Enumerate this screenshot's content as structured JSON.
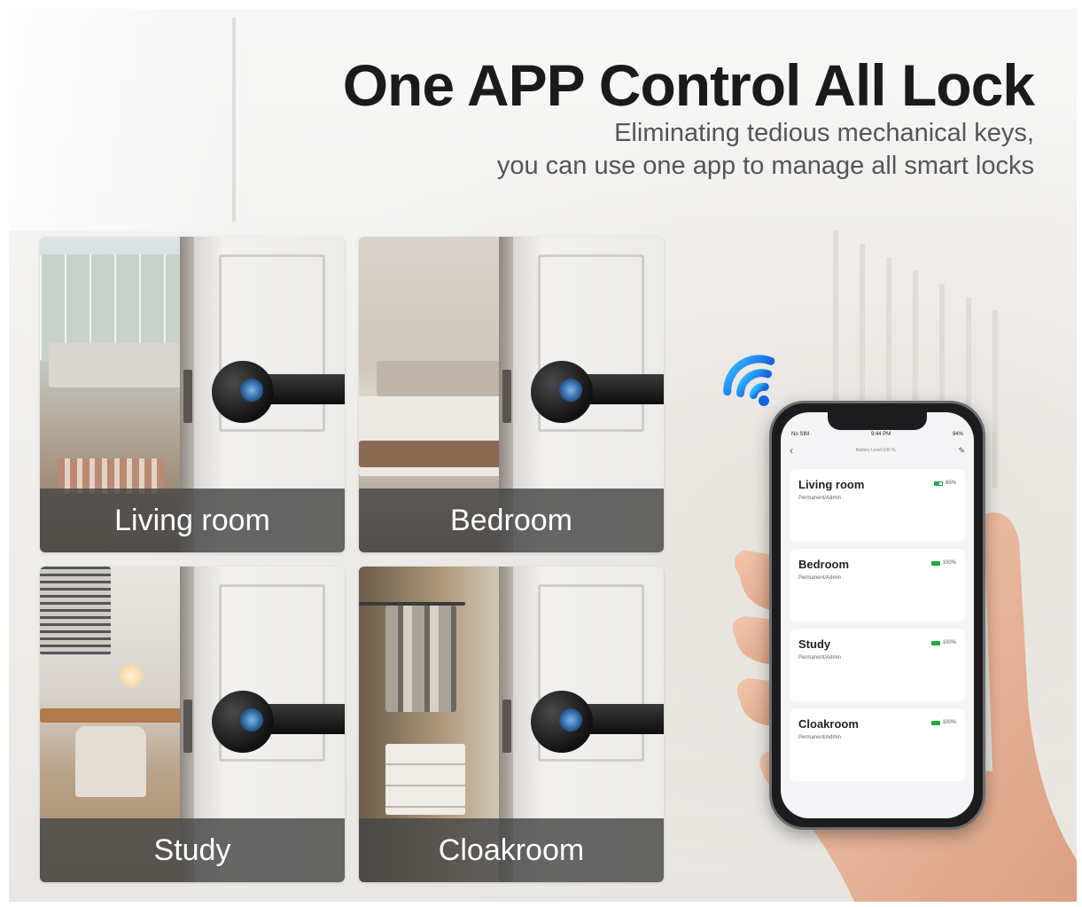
{
  "headline": "One APP Control All Lock",
  "subline": {
    "line1": "Eliminating tedious mechanical keys,",
    "line2": "you can use one app to manage all smart locks"
  },
  "tiles": [
    {
      "label": "Living room"
    },
    {
      "label": "Bedroom"
    },
    {
      "label": "Study"
    },
    {
      "label": "Cloakroom"
    }
  ],
  "phone": {
    "status": {
      "carrier": "No SIM",
      "time": "9:44 PM",
      "battery": "94%"
    },
    "nav": {
      "back_icon": "chevron-left-icon",
      "title": "Battery Level:100 %",
      "edit_icon": "pencil-icon"
    },
    "locks": [
      {
        "name": "Living room",
        "role": "Permanent/Admin",
        "battery": "65%",
        "battery_level": 0.65
      },
      {
        "name": "Bedroom",
        "role": "Permanent/Admin",
        "battery": "100%",
        "battery_level": 1.0
      },
      {
        "name": "Study",
        "role": "Permanent/Admin",
        "battery": "100%",
        "battery_level": 1.0
      },
      {
        "name": "Cloakroom",
        "role": "Permanent/Admin",
        "battery": "100%",
        "battery_level": 1.0
      }
    ]
  },
  "colors": {
    "headline": "#1a1a1a",
    "subline": "#555555",
    "label_bar": "#464646",
    "wifi": "#1e90ff",
    "battery": "#23a94b"
  }
}
